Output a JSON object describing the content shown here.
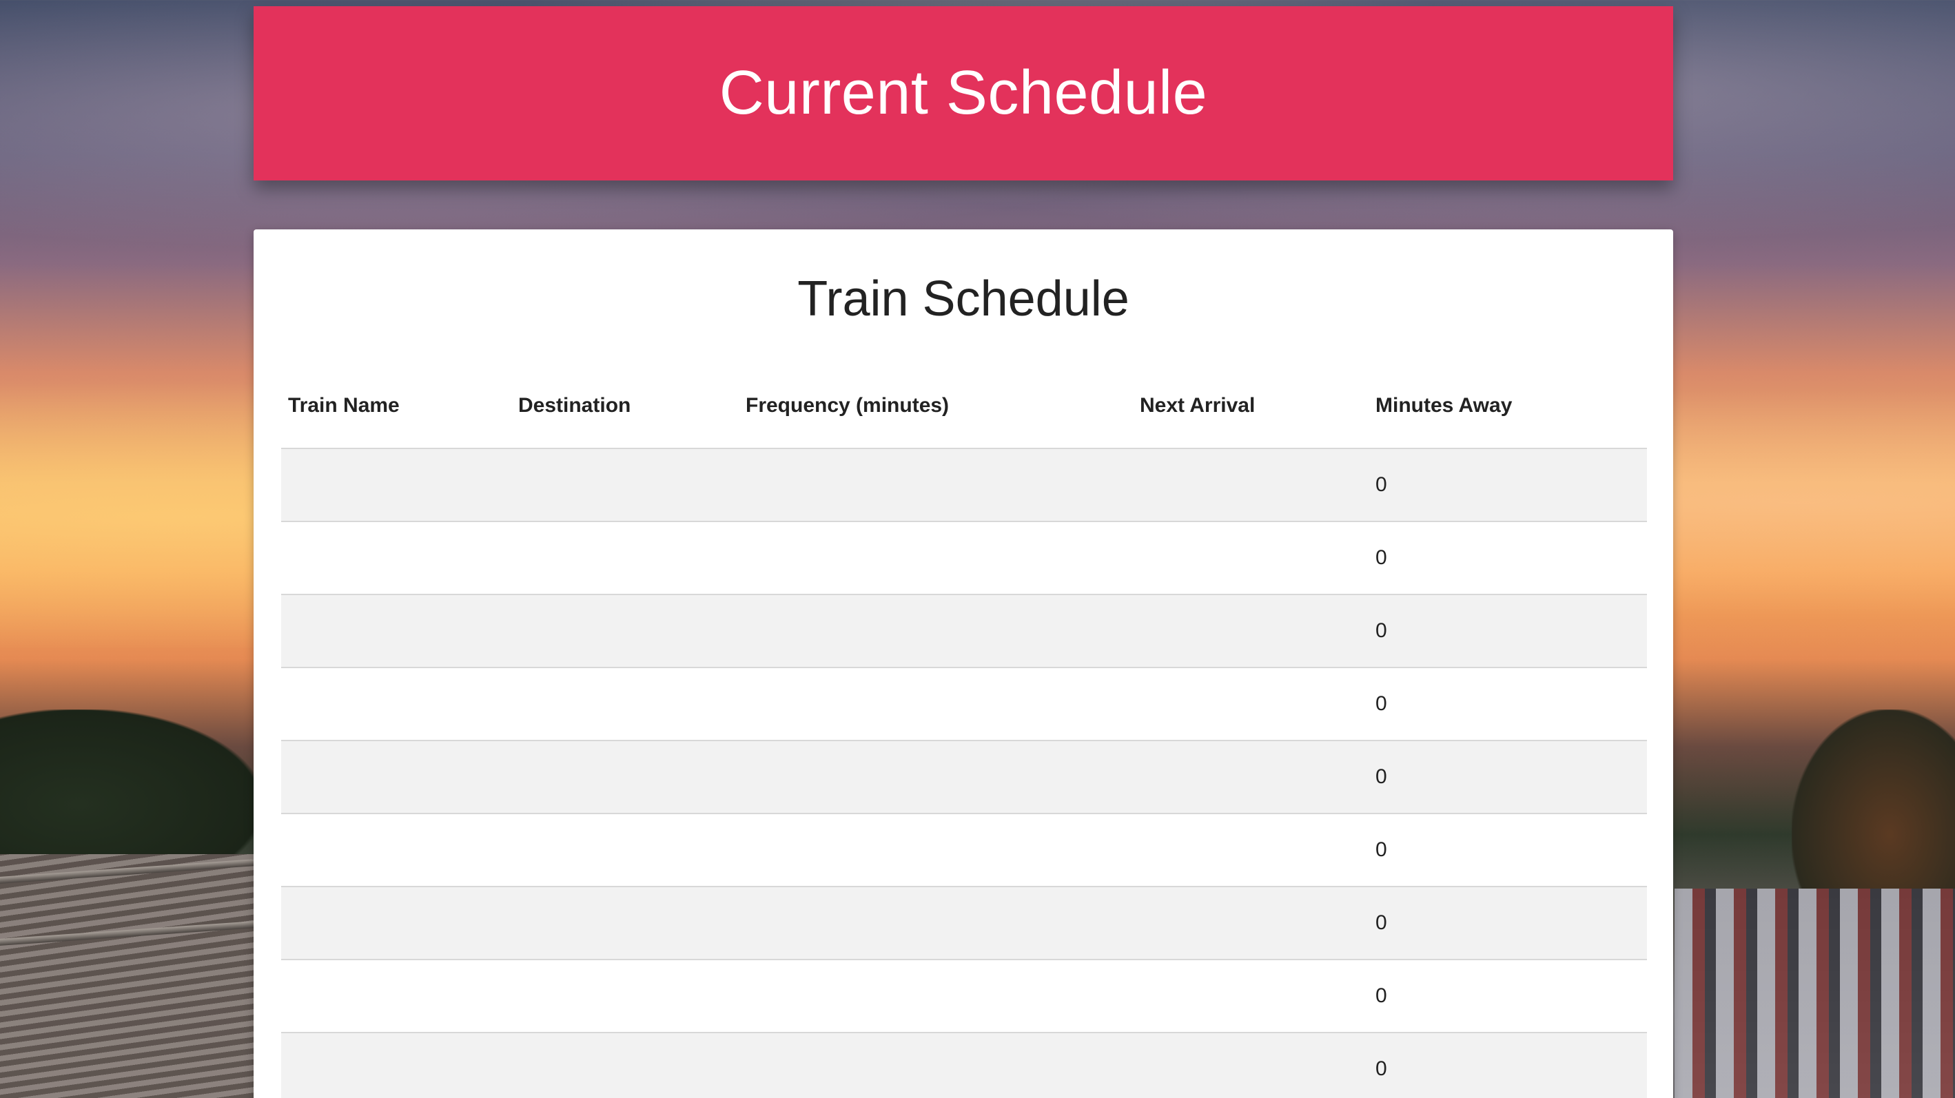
{
  "header": {
    "title": "Current Schedule"
  },
  "schedule": {
    "title": "Train Schedule",
    "columns": [
      "Train Name",
      "Destination",
      "Frequency (minutes)",
      "Next Arrival",
      "Minutes Away"
    ],
    "rows": [
      {
        "name": "",
        "destination": "",
        "frequency": "",
        "next_arrival": "",
        "minutes_away": "0"
      },
      {
        "name": "",
        "destination": "",
        "frequency": "",
        "next_arrival": "",
        "minutes_away": "0"
      },
      {
        "name": "",
        "destination": "",
        "frequency": "",
        "next_arrival": "",
        "minutes_away": "0"
      },
      {
        "name": "",
        "destination": "",
        "frequency": "",
        "next_arrival": "",
        "minutes_away": "0"
      },
      {
        "name": "",
        "destination": "",
        "frequency": "",
        "next_arrival": "",
        "minutes_away": "0"
      },
      {
        "name": "",
        "destination": "",
        "frequency": "",
        "next_arrival": "",
        "minutes_away": "0"
      },
      {
        "name": "",
        "destination": "",
        "frequency": "",
        "next_arrival": "",
        "minutes_away": "0"
      },
      {
        "name": "",
        "destination": "",
        "frequency": "",
        "next_arrival": "",
        "minutes_away": "0"
      },
      {
        "name": "",
        "destination": "",
        "frequency": "",
        "next_arrival": "",
        "minutes_away": "0"
      }
    ]
  },
  "colors": {
    "header_bg": "#e3325b",
    "stripe": "#f2f2f2",
    "divider": "#d8d8d8"
  }
}
